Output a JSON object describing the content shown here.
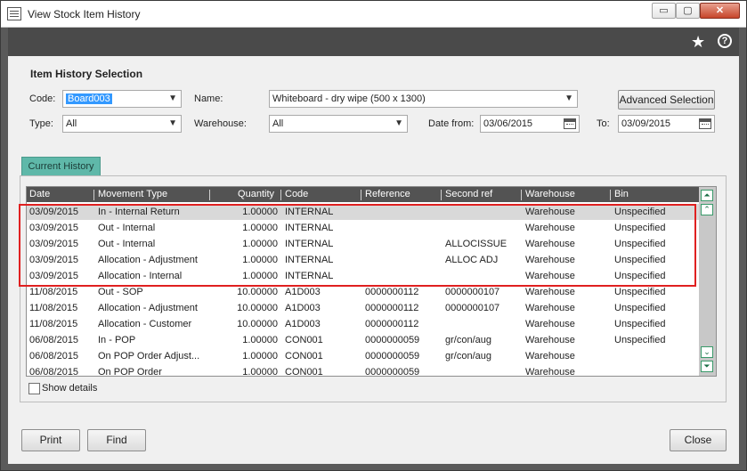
{
  "window": {
    "title": "View Stock Item History",
    "min_glyph": "▭",
    "max_glyph": "▢",
    "close_glyph": "✕",
    "icons": [
      "window-icon",
      "star-icon",
      "help-icon"
    ],
    "help_glyph": "?",
    "star_glyph": "★"
  },
  "selection": {
    "title": "Item History Selection",
    "code_label": "Code:",
    "code_value": "Board003",
    "name_label": "Name:",
    "name_value": "Whiteboard - dry wipe (500 x 1300)",
    "advanced_label": "Advanced Selection",
    "type_label": "Type:",
    "type_value": "All",
    "warehouse_label": "Warehouse:",
    "warehouse_value": "All",
    "date_from_label": "Date from:",
    "date_from_value": "03/06/2015",
    "to_label": "To:",
    "to_value": "03/09/2015"
  },
  "tabs": {
    "current": "Current History"
  },
  "grid": {
    "columns": [
      "Date",
      "Movement Type",
      "Quantity",
      "Code",
      "Reference",
      "Second ref",
      "Warehouse",
      "Bin"
    ],
    "rows": [
      [
        "03/09/2015",
        "In - Internal Return",
        "1.00000",
        "INTERNAL",
        "",
        "",
        "Warehouse",
        "Unspecified"
      ],
      [
        "03/09/2015",
        "Out - Internal",
        "1.00000",
        "INTERNAL",
        "",
        "",
        "Warehouse",
        "Unspecified"
      ],
      [
        "03/09/2015",
        "Out - Internal",
        "1.00000",
        "INTERNAL",
        "",
        "ALLOCISSUE",
        "Warehouse",
        "Unspecified"
      ],
      [
        "03/09/2015",
        "Allocation - Adjustment",
        "1.00000",
        "INTERNAL",
        "",
        "ALLOC ADJ",
        "Warehouse",
        "Unspecified"
      ],
      [
        "03/09/2015",
        "Allocation - Internal",
        "1.00000",
        "INTERNAL",
        "",
        "",
        "Warehouse",
        "Unspecified"
      ],
      [
        "11/08/2015",
        "Out - SOP",
        "10.00000",
        "A1D003",
        "0000000112",
        "0000000107",
        "Warehouse",
        "Unspecified"
      ],
      [
        "11/08/2015",
        "Allocation - Adjustment",
        "10.00000",
        "A1D003",
        "0000000112",
        "0000000107",
        "Warehouse",
        "Unspecified"
      ],
      [
        "11/08/2015",
        "Allocation - Customer",
        "10.00000",
        "A1D003",
        "0000000112",
        "",
        "Warehouse",
        "Unspecified"
      ],
      [
        "06/08/2015",
        "In - POP",
        "1.00000",
        "CON001",
        "0000000059",
        "gr/con/aug",
        "Warehouse",
        "Unspecified"
      ],
      [
        "06/08/2015",
        "On POP Order Adjust...",
        "1.00000",
        "CON001",
        "0000000059",
        "gr/con/aug",
        "Warehouse",
        ""
      ],
      [
        "06/08/2015",
        "On POP Order",
        "1.00000",
        "CON001",
        "0000000059",
        "",
        "Warehouse",
        ""
      ]
    ],
    "scroll_top": "⏶",
    "scroll_up": "⌃",
    "scroll_down": "⌄",
    "scroll_bottom": "⏷"
  },
  "show_details_label": "Show details",
  "footer": {
    "print": "Print",
    "find": "Find",
    "close": "Close"
  },
  "colors": {
    "tab": "#5fb8a9",
    "header": "#535353",
    "highlight": "#e02020",
    "selection": "#3399ff"
  }
}
